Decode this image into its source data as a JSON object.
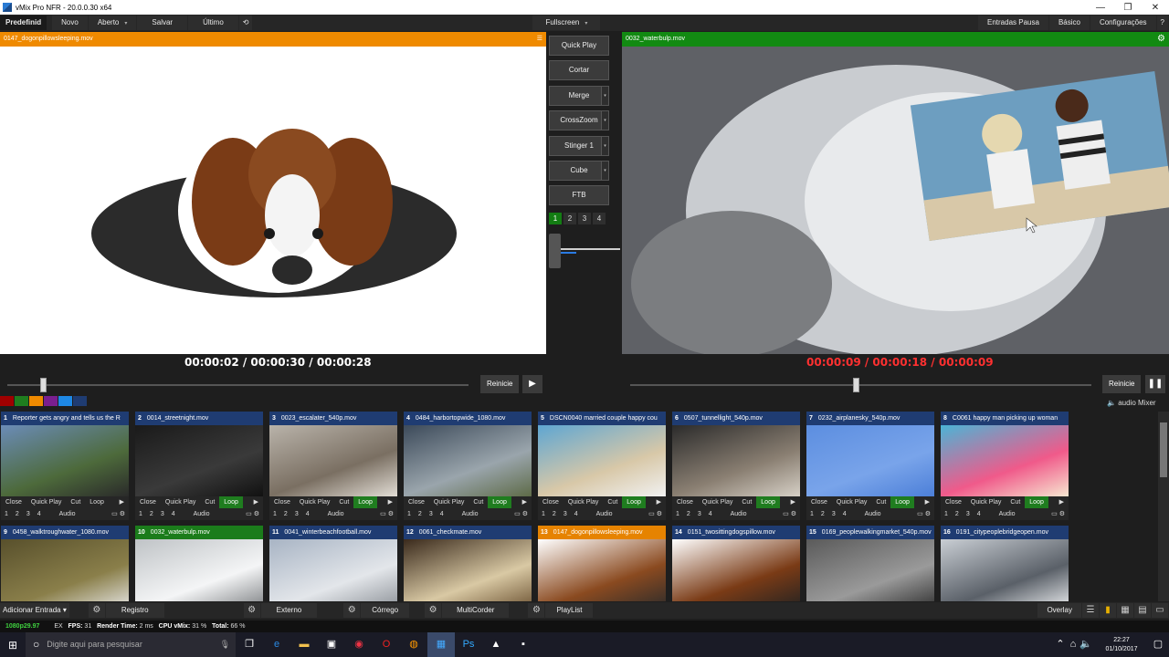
{
  "window": {
    "title": "vMix Pro NFR - 20.0.0.30 x64",
    "controls": [
      "—",
      "❐",
      "✕"
    ]
  },
  "menu": {
    "items": [
      "Predefinid",
      "Novo",
      "Aberto",
      "Salvar",
      "Último"
    ],
    "fullscreen": "Fullscreen",
    "right": [
      "Entradas Pausa",
      "Básico",
      "Configurações",
      "?"
    ]
  },
  "preview": {
    "title": "0147_dogonpillowsleeping.mov",
    "timecode": "00:00:02  /  00:00:30  /  00:00:28"
  },
  "output": {
    "title": "0032_waterbulp.mov",
    "timecode": "00:00:09  /  00:00:18  /  00:00:09"
  },
  "transitions": {
    "buttons": [
      "Quick Play",
      "Cortar",
      "Merge",
      "CrossZoom",
      "Stinger 1",
      "Cube",
      "FTB"
    ],
    "numbers": [
      "1",
      "2",
      "3",
      "4"
    ]
  },
  "playback": {
    "restart_left": "Reinicie",
    "restart_right": "Reinicie",
    "audio_mixer": "audio Mixer"
  },
  "colors": [
    "#a00000",
    "#1f7d1f",
    "#ef8a00",
    "#7a1f8f",
    "#1e88e5",
    "#1f3c72"
  ],
  "controls_row1": [
    "Close",
    "Quick Play",
    "Cut",
    "Loop"
  ],
  "controls_row2": [
    "1",
    "2",
    "3",
    "4",
    "Audio"
  ],
  "inputs": [
    {
      "n": "1",
      "name": "Reporter gets angry and tells us the R",
      "style": "blue"
    },
    {
      "n": "2",
      "name": "0014_streetnight.mov",
      "style": "blue"
    },
    {
      "n": "3",
      "name": "0023_escalater_540p.mov",
      "style": "blue"
    },
    {
      "n": "4",
      "name": "0484_harbortopwide_1080.mov",
      "style": "blue"
    },
    {
      "n": "5",
      "name": "DSCN0040 married couple happy cou",
      "style": "blue"
    },
    {
      "n": "6",
      "name": "0507_tunnellight_540p.mov",
      "style": "blue"
    },
    {
      "n": "7",
      "name": "0232_airplanesky_540p.mov",
      "style": "blue"
    },
    {
      "n": "8",
      "name": "C0061 happy man picking up woman",
      "style": "blue"
    },
    {
      "n": "9",
      "name": "0458_walktroughwater_1080.mov",
      "style": "blue"
    },
    {
      "n": "10",
      "name": "0032_waterbulp.mov",
      "style": "green"
    },
    {
      "n": "11",
      "name": "0041_winterbeachfootball.mov",
      "style": "blue"
    },
    {
      "n": "12",
      "name": "0061_checkmate.mov",
      "style": "blue"
    },
    {
      "n": "13",
      "name": "0147_dogonpillowsleeping.mov",
      "style": "orange"
    },
    {
      "n": "14",
      "name": "0151_twosittingdogspillow.mov",
      "style": "blue"
    },
    {
      "n": "15",
      "name": "0169_peoplewalkingmarket_540p.mov",
      "style": "blue"
    },
    {
      "n": "16",
      "name": "0191_citypeoplebridgeopen.mov",
      "style": "blue"
    }
  ],
  "bottombar": {
    "add_input": "Adicionar Entrada",
    "items": [
      "Registro",
      "Externo",
      "Córrego",
      "MultiCorder",
      "PlayList"
    ],
    "overlay": "Overlay"
  },
  "status": {
    "format": "1080p29.97",
    "ex": "EX",
    "fps_label": "FPS:",
    "fps": "31",
    "render_label": "Render Time:",
    "render": "2 ms",
    "cpu_label": "CPU vMix:",
    "cpu": "31 %",
    "total_label": "Total:",
    "total": "66 %"
  },
  "taskbar": {
    "search": "Digite aqui para pesquisar",
    "time": "22:27",
    "date": "01/10/2017"
  }
}
